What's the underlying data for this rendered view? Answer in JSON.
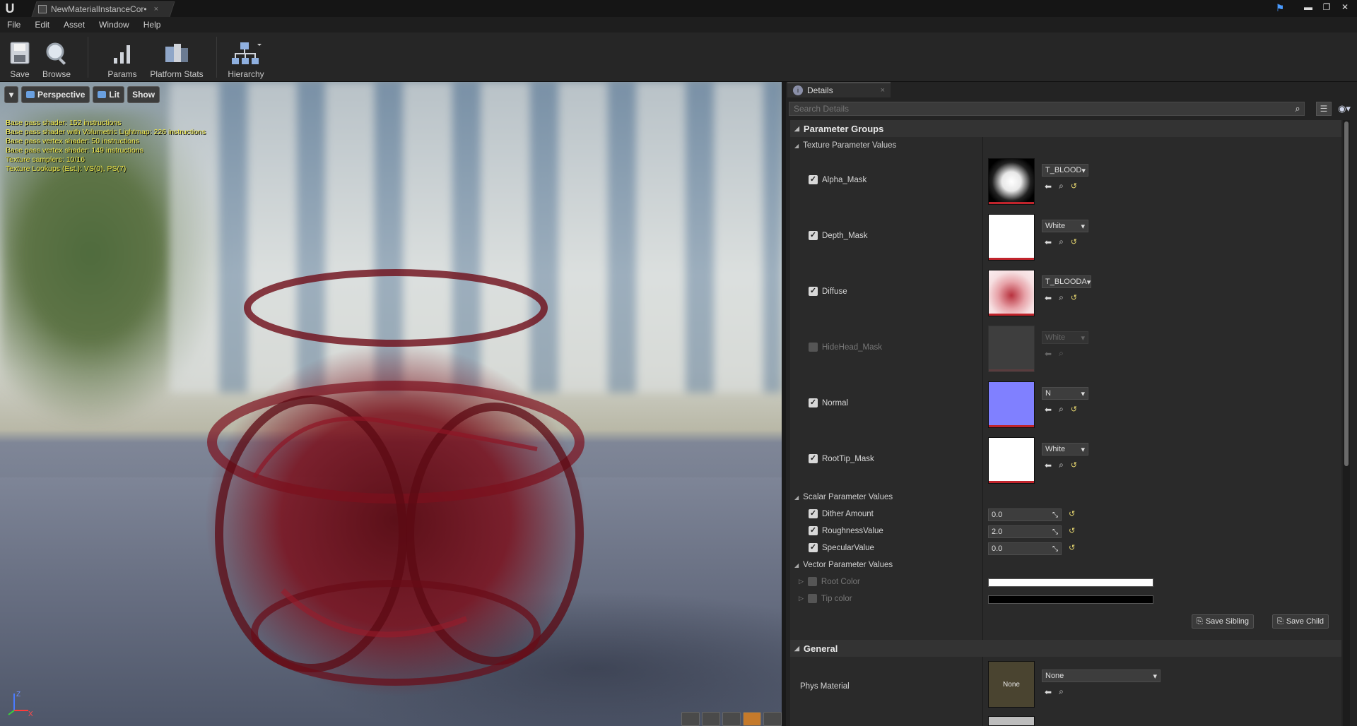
{
  "titlebar": {
    "logo": "U",
    "tab_title": "NewMaterialInstanceCor•",
    "tab_close": "×",
    "feedback_icon": "person-icon",
    "win_min": "▬",
    "win_restore": "❐",
    "win_close": "✕"
  },
  "menu": [
    "File",
    "Edit",
    "Asset",
    "Window",
    "Help"
  ],
  "toolbar": {
    "save": "Save",
    "browse": "Browse",
    "params": "Params",
    "platform_stats": "Platform Stats",
    "hierarchy": "Hierarchy"
  },
  "viewport": {
    "perspective": "Perspective",
    "lit": "Lit",
    "show": "Show",
    "stats": [
      "Base pass shader: 152 instructions",
      "Base pass shader with Volumetric Lightmap: 226 instructions",
      "Base pass vertex shader: 50 instructions",
      "Base pass vertex shader: 149 instructions",
      "Texture samplers: 10/16",
      "Texture Lookups (Est.): VS(0), PS(7)"
    ],
    "axis_z": "Z",
    "axis_x": "X"
  },
  "details": {
    "tab_label": "Details",
    "tab_close": "×",
    "search_placeholder": "Search Details",
    "param_groups": "Parameter Groups",
    "texture_group": "Texture Parameter Values",
    "textures": [
      {
        "name": "Alpha_Mask",
        "asset": "T_BLOOD",
        "enabled": true
      },
      {
        "name": "Depth_Mask",
        "asset": "White",
        "enabled": true
      },
      {
        "name": "Diffuse",
        "asset": "T_BLOODA",
        "enabled": true
      },
      {
        "name": "HideHead_Mask",
        "asset": "White",
        "enabled": false
      },
      {
        "name": "Normal",
        "asset": "N",
        "enabled": true
      },
      {
        "name": "RootTip_Mask",
        "asset": "White",
        "enabled": true
      }
    ],
    "scalar_group": "Scalar Parameter Values",
    "scalars": [
      {
        "name": "Dither Amount",
        "value": "0.0"
      },
      {
        "name": "RoughnessValue",
        "value": "2.0"
      },
      {
        "name": "SpecularValue",
        "value": "0.0"
      }
    ],
    "vector_group": "Vector Parameter Values",
    "vectors": [
      {
        "name": "Root Color",
        "color": "#ffffff"
      },
      {
        "name": "Tip color",
        "color": "#000000"
      }
    ],
    "save_sibling": "Save Sibling",
    "save_child": "Save Child",
    "general": "General",
    "phys_material_label": "Phys Material",
    "phys_material_thumb": "None",
    "phys_material_value": "None"
  },
  "colors": {
    "accent_red": "#c0242c",
    "normal_map": "#8080ff",
    "stats_yellow": "#f0e84a"
  }
}
